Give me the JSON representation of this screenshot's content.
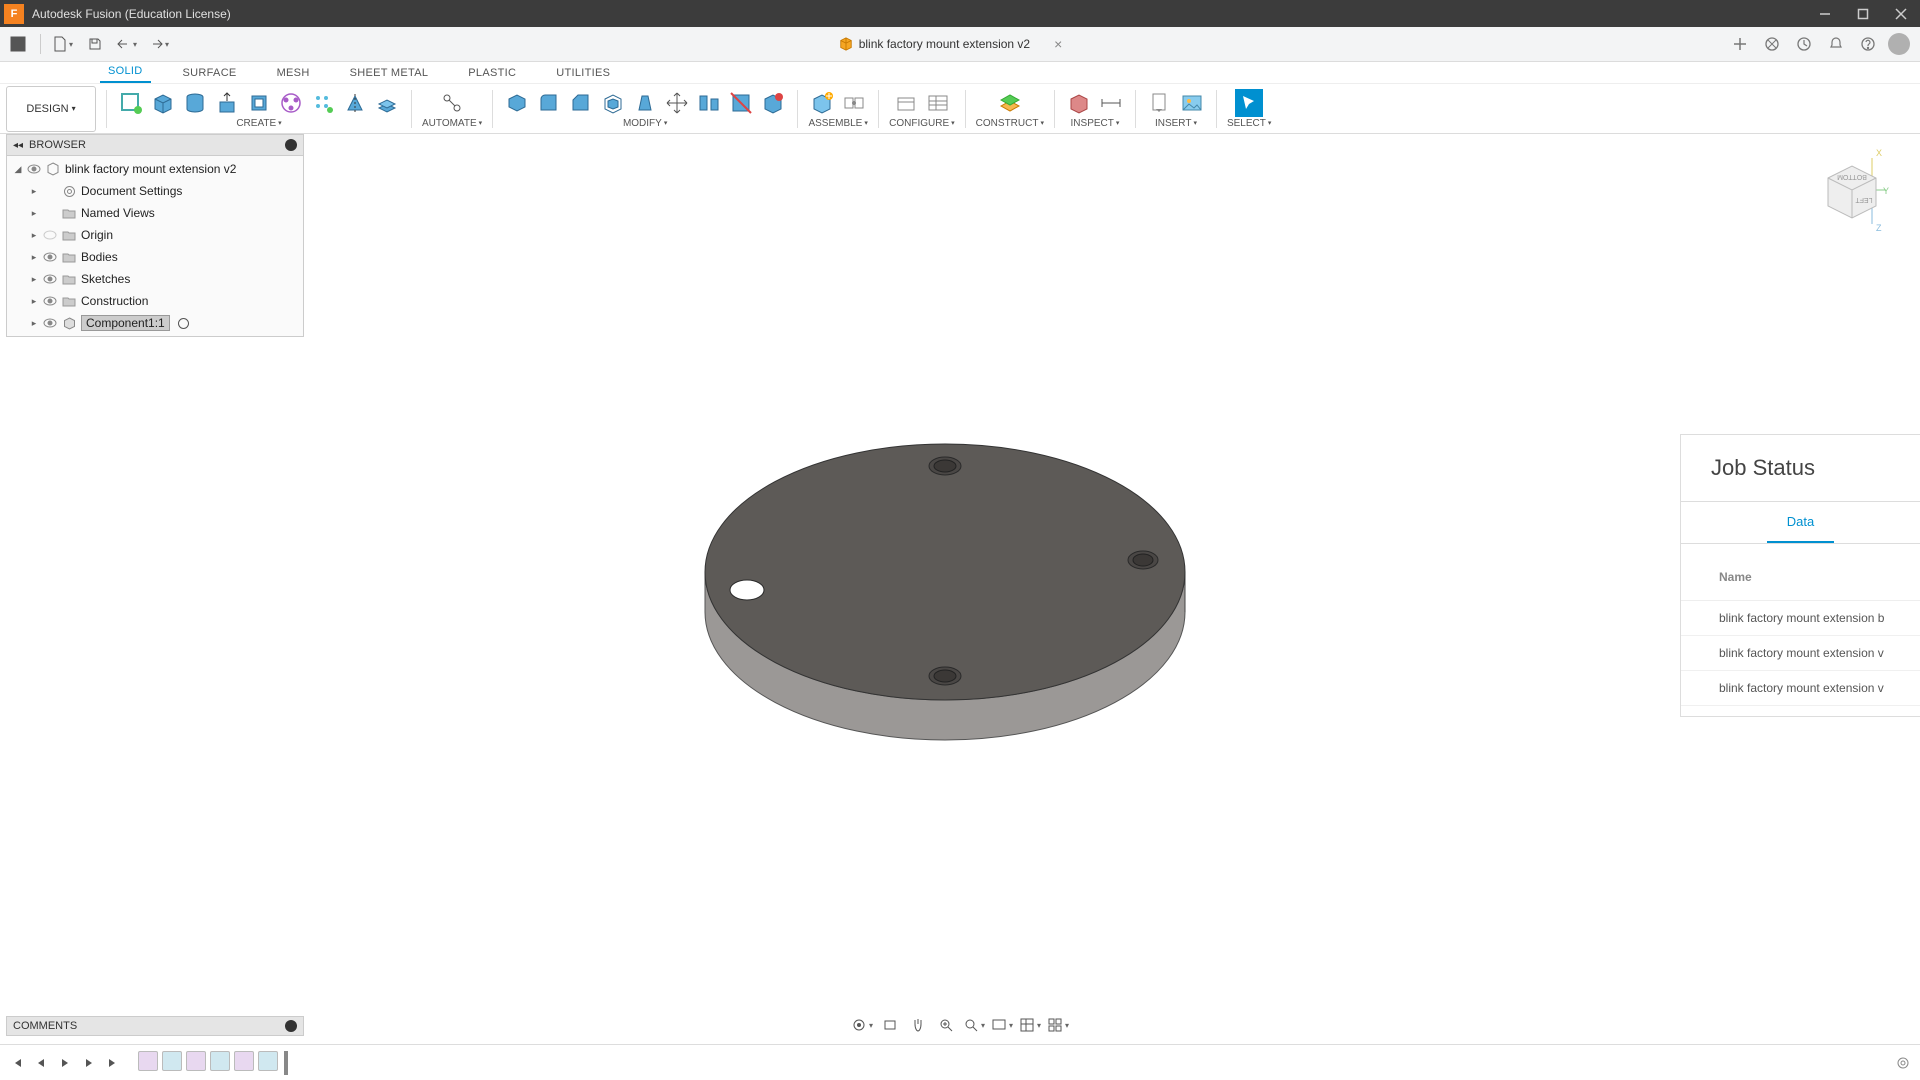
{
  "titlebar": {
    "app": "Autodesk Fusion (Education License)"
  },
  "doc": {
    "name": "blink factory mount extension v2"
  },
  "ribbon_tabs": [
    "SOLID",
    "SURFACE",
    "MESH",
    "SHEET METAL",
    "PLASTIC",
    "UTILITIES"
  ],
  "ribbon_active_tab": "SOLID",
  "design_button": "DESIGN",
  "ribbon_groups": {
    "create": "CREATE",
    "automate": "AUTOMATE",
    "modify": "MODIFY",
    "assemble": "ASSEMBLE",
    "configure": "CONFIGURE",
    "construct": "CONSTRUCT",
    "inspect": "INSPECT",
    "insert": "INSERT",
    "select": "SELECT"
  },
  "browser": {
    "title": "BROWSER",
    "root": "blink factory mount extension v2",
    "items": [
      {
        "label": "Document Settings",
        "icon": "gear"
      },
      {
        "label": "Named Views",
        "icon": "folder"
      },
      {
        "label": "Origin",
        "icon": "folder"
      },
      {
        "label": "Bodies",
        "icon": "folder"
      },
      {
        "label": "Sketches",
        "icon": "folder"
      },
      {
        "label": "Construction",
        "icon": "folder"
      }
    ],
    "component": "Component1:1"
  },
  "comments": {
    "title": "COMMENTS"
  },
  "viewcube": {
    "face_top": "BOTTOM",
    "face_side": "LEFT",
    "axes": [
      "X",
      "Y",
      "Z"
    ]
  },
  "job_status": {
    "title": "Job Status",
    "tab": "Data",
    "column": "Name",
    "rows": [
      "blink factory mount extension b",
      "blink factory mount extension v",
      "blink factory mount extension v"
    ]
  },
  "colors": {
    "part_top": "#5b5856",
    "part_side": "#7c7976",
    "accent": "#0090d0",
    "orange": "#f58220"
  }
}
